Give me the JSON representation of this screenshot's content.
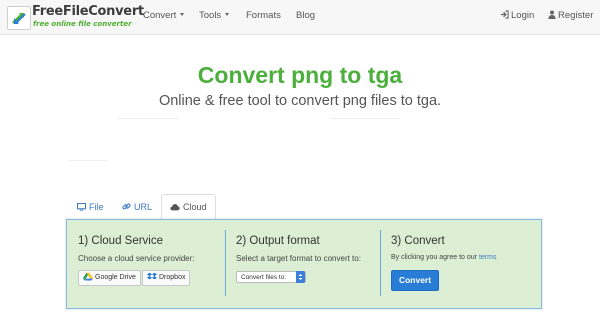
{
  "brand": {
    "title": "FreeFileConvert",
    "subtitle": "free online file converter"
  },
  "nav": {
    "items": [
      {
        "label": "Convert",
        "dropdown": true
      },
      {
        "label": "Tools",
        "dropdown": true
      },
      {
        "label": "Formats",
        "dropdown": false
      },
      {
        "label": "Blog",
        "dropdown": false
      }
    ],
    "login": "Login",
    "register": "Register"
  },
  "hero": {
    "title": "Convert png to tga",
    "subtitle": "Online & free tool to convert png files to tga."
  },
  "tabs": [
    {
      "label": "File",
      "icon": "monitor-icon",
      "active": false
    },
    {
      "label": "URL",
      "icon": "link-icon",
      "active": false
    },
    {
      "label": "Cloud",
      "icon": "cloud-icon",
      "active": true
    }
  ],
  "steps": {
    "cloud": {
      "title": "1) Cloud Service",
      "text": "Choose a cloud service provider:",
      "providers": [
        "Google Drive",
        "Dropbox"
      ]
    },
    "format": {
      "title": "2) Output format",
      "text": "Select a target format to convert to:",
      "select_value": "Convert files to:"
    },
    "convert": {
      "title": "3) Convert",
      "text_prefix": "By clicking you agree to our ",
      "terms_link": "terms",
      "button": "Convert"
    }
  },
  "colors": {
    "accent_green": "#4caf3c",
    "panel_bg": "#dcefd4",
    "link_blue": "#3a78c3",
    "button_blue": "#2a7dd6"
  }
}
